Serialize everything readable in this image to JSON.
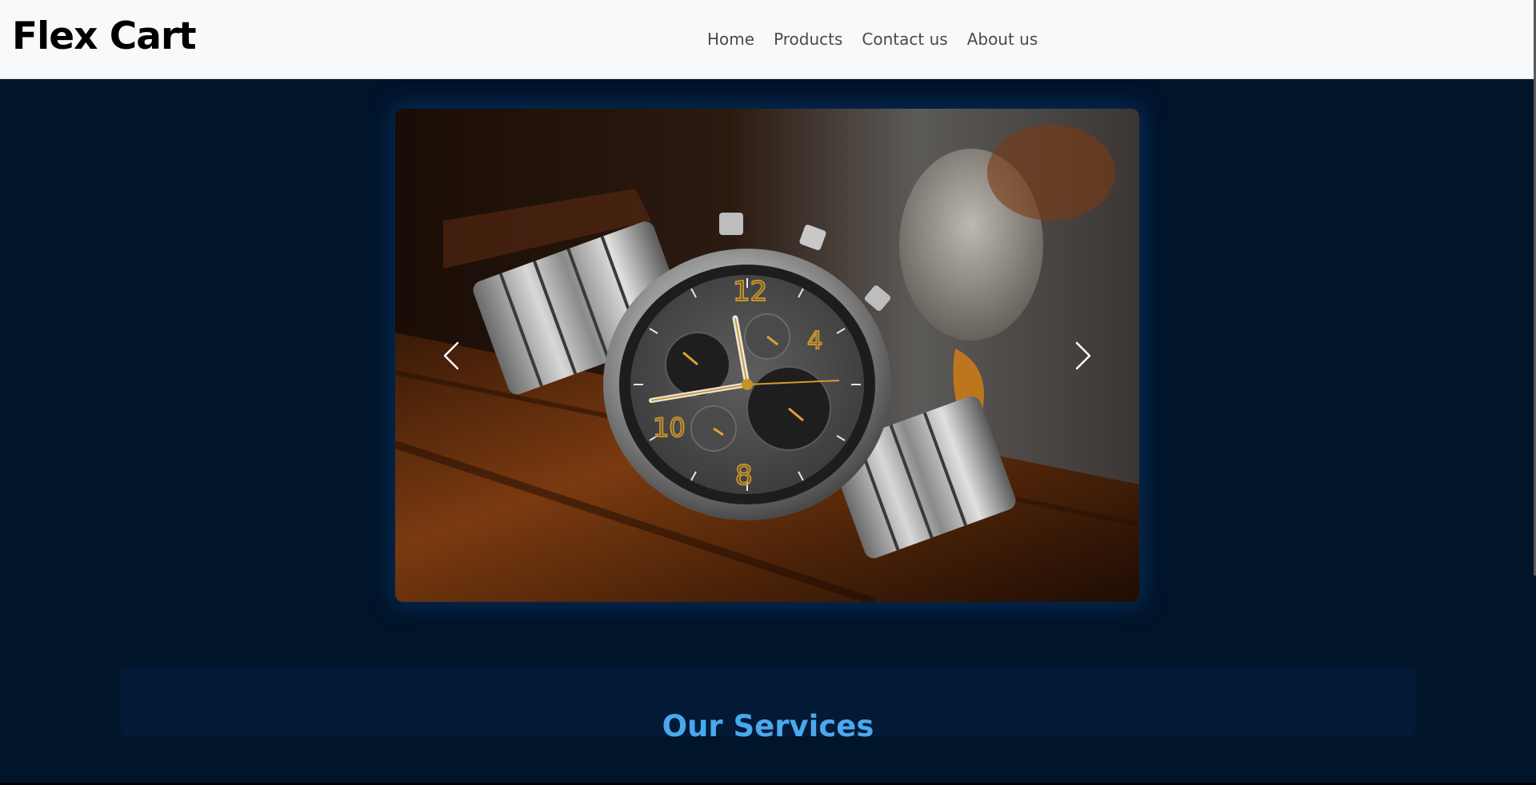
{
  "brand": {
    "name": "Flex Cart"
  },
  "nav": {
    "items": [
      {
        "label": "Home"
      },
      {
        "label": "Products"
      },
      {
        "label": "Contact us"
      },
      {
        "label": "About us"
      }
    ]
  },
  "carousel": {
    "current_slide": "wristwatch-photo",
    "prev_icon": "chevron-left-icon",
    "next_icon": "chevron-right-icon"
  },
  "services": {
    "title": "Our Services"
  },
  "colors": {
    "page_background": "#00142a",
    "navbar_background": "#f8f9fa",
    "accent": "#4aa8ee"
  }
}
